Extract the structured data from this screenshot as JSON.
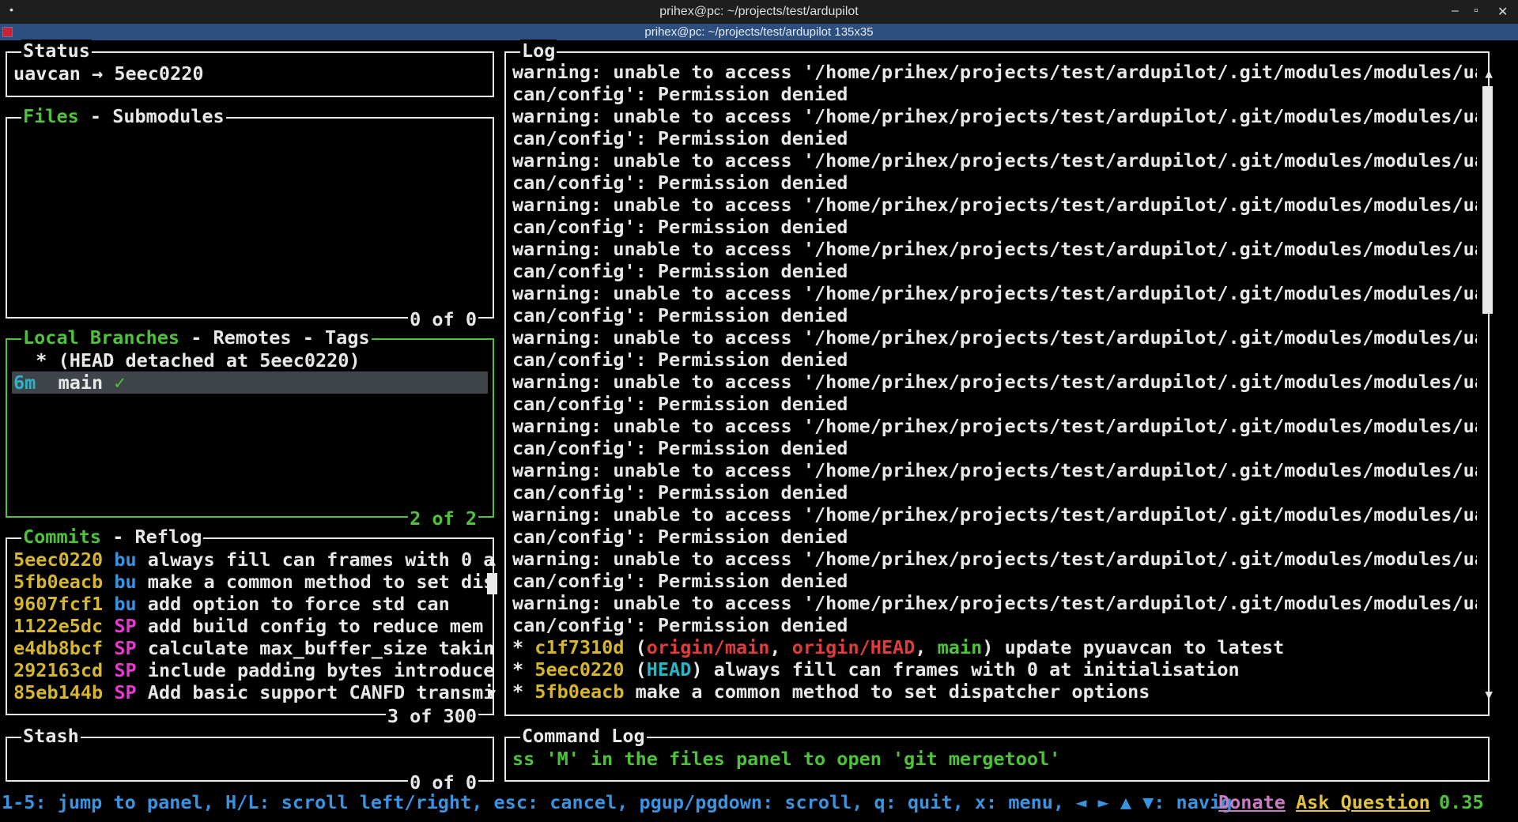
{
  "window": {
    "title": "prihex@pc: ~/projects/test/ardupilot",
    "tab_title": "prihex@pc: ~/projects/test/ardupilot 135x35",
    "menu_dot": "•",
    "minimize": "–",
    "maximize": "▫",
    "close": "✕"
  },
  "status": {
    "title": "Status",
    "text": "uavcan → 5eec0220"
  },
  "files": {
    "title_active": "Files",
    "title_sep": " - ",
    "title_other": "Submodules",
    "footer": "0 of 0"
  },
  "branches": {
    "title_active": "Local Branches",
    "title_sep1": " - ",
    "title_remotes": "Remotes",
    "title_sep2": " - ",
    "title_tags": "Tags",
    "rows": [
      {
        "prefix": "  * ",
        "name": "(HEAD detached at 5eec0220)",
        "check": ""
      },
      {
        "prefix": "6m  ",
        "name": "main",
        "check": " ✓"
      }
    ],
    "footer": "2 of 2"
  },
  "commits": {
    "title_active": "Commits",
    "title_sep": " - ",
    "title_other": "Reflog",
    "rows": [
      {
        "hash": "5eec0220",
        "author": "bu",
        "msg": "always fill can frames with 0 a"
      },
      {
        "hash": "5fb0eacb",
        "author": "bu",
        "msg": "make a common method to set dis"
      },
      {
        "hash": "9607fcf1",
        "author": "bu",
        "msg": "add option to force std can"
      },
      {
        "hash": "1122e5dc",
        "author": "SP",
        "msg": "add build config to reduce mem"
      },
      {
        "hash": "e4db8bcf",
        "author": "SP",
        "msg": "calculate max_buffer_size takin"
      },
      {
        "hash": "292163cd",
        "author": "SP",
        "msg": "include padding bytes introduce"
      },
      {
        "hash": "85eb144b",
        "author": "SP",
        "msg": "Add basic support CANFD transmi"
      }
    ],
    "footer": "3 of 300"
  },
  "stash": {
    "title": "Stash",
    "footer": "0 of 0"
  },
  "log": {
    "title": "Log",
    "warning_line1": "warning: unable to access '/home/prihex/projects/test/ardupilot/.git/modules/modules/uav",
    "warning_line2": "can/config': Permission denied",
    "warning_repeat": 13,
    "commits": [
      {
        "bullet": "* ",
        "hash": "c1f7310d",
        "refs": [
          {
            "text": "origin/main",
            "color": "red"
          },
          {
            "text": "origin/HEAD",
            "color": "red"
          },
          {
            "text": "main",
            "color": "green"
          }
        ],
        "msg": "update pyuavcan to latest"
      },
      {
        "bullet": "* ",
        "hash": "5eec0220",
        "refs": [
          {
            "text": "HEAD",
            "color": "cyan"
          }
        ],
        "msg": "always fill can frames with 0 at initialisation"
      },
      {
        "bullet": "* ",
        "hash": "5fb0eacb",
        "refs": [],
        "msg": "make a common method to set dispatcher options"
      }
    ]
  },
  "command_log": {
    "title": "Command Log",
    "text": "ss 'M' in the files panel to open 'git mergetool'"
  },
  "bottom": {
    "keys": "1-5: jump to panel, H/L: scroll left/right, esc: cancel, pgup/pgdown: scroll, q: quit, x: menu, ◄ ► ▲ ▼: navig",
    "donate": "Donate",
    "ask": "Ask Question",
    "version": "0.35"
  },
  "colors": {
    "active_border": "#4ec23a",
    "hash": "#d6b62c",
    "author_bu": "#3a93e0",
    "author_sp": "#e33bd0",
    "selection": "#3e444a"
  }
}
